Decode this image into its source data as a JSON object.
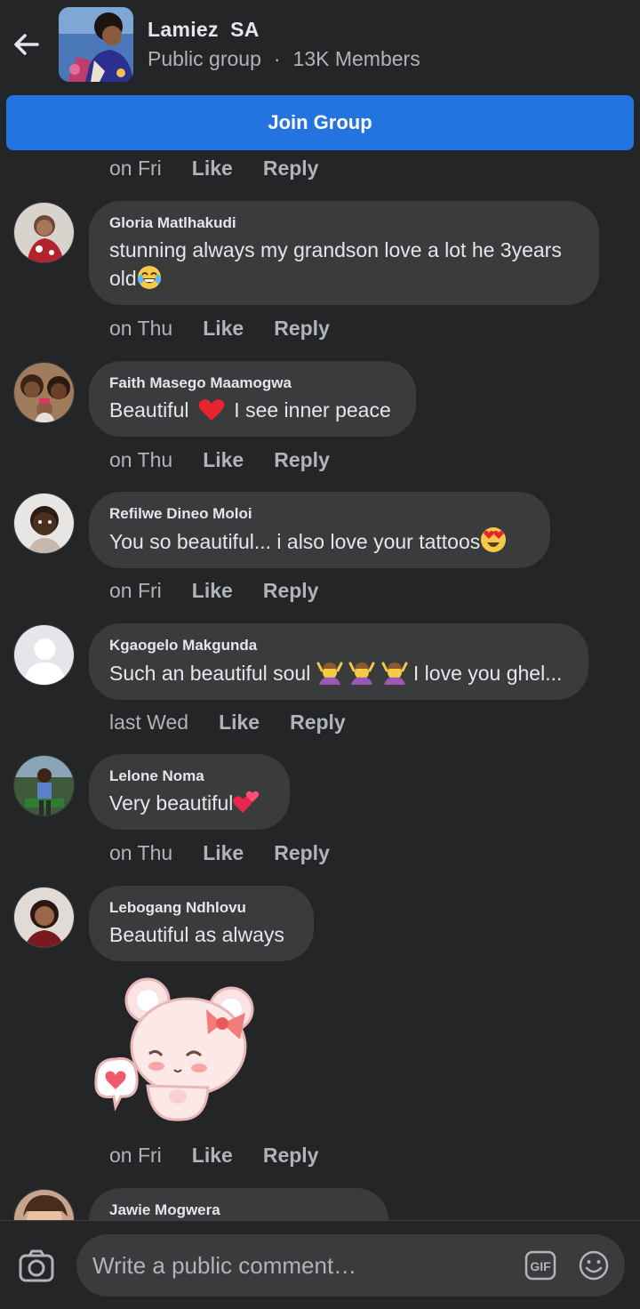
{
  "header": {
    "group_name": "Lamiez  SA",
    "privacy": "Public group",
    "separator": "·",
    "members": "13K Members"
  },
  "join_label": "Join Group",
  "top_meta": {
    "time": "on Fri",
    "like": "Like",
    "reply": "Reply"
  },
  "comments": [
    {
      "author": "Gloria Matlhakudi",
      "text": "stunning always my grandson love a lot he 3years old",
      "emoji": "face-with-tears-of-joy",
      "time": "on Thu",
      "like": "Like",
      "reply": "Reply"
    },
    {
      "author": "Faith Masego Maamogwa",
      "text_before": "Beautiful",
      "emoji": "red-heart",
      "text_after": "I see inner peace",
      "time": "on Thu",
      "like": "Like",
      "reply": "Reply"
    },
    {
      "author": "Refilwe Dineo Moloi",
      "text": "You so beautiful... i also love your tattoos",
      "emoji": "heart-eyes",
      "time": "on Fri",
      "like": "Like",
      "reply": "Reply"
    },
    {
      "author": "Kgaogelo Makgunda",
      "text_before": "Such an beautiful soul",
      "emoji": "person-gesturing-ok",
      "text_after": "I love you ghel...",
      "time": "last Wed",
      "like": "Like",
      "reply": "Reply"
    },
    {
      "author": "Lelone Noma",
      "text": "Very beautiful",
      "emoji": "two-hearts",
      "time": "on Thu",
      "like": "Like",
      "reply": "Reply"
    },
    {
      "author": "Lebogang Ndhlovu",
      "text": "Beautiful as always",
      "sticker": "pink-bear-heart-sticker",
      "time": "on Fri",
      "like": "Like",
      "reply": "Reply"
    },
    {
      "author": "Jawie Mogwera"
    }
  ],
  "composer": {
    "placeholder": "Write a public comment…",
    "gif_label": "GIF"
  },
  "colors": {
    "background": "#242526",
    "bubble": "#3a3b3c",
    "accent": "#2374e1",
    "text_primary": "#e4e6eb",
    "text_secondary": "#b0b3b8"
  }
}
